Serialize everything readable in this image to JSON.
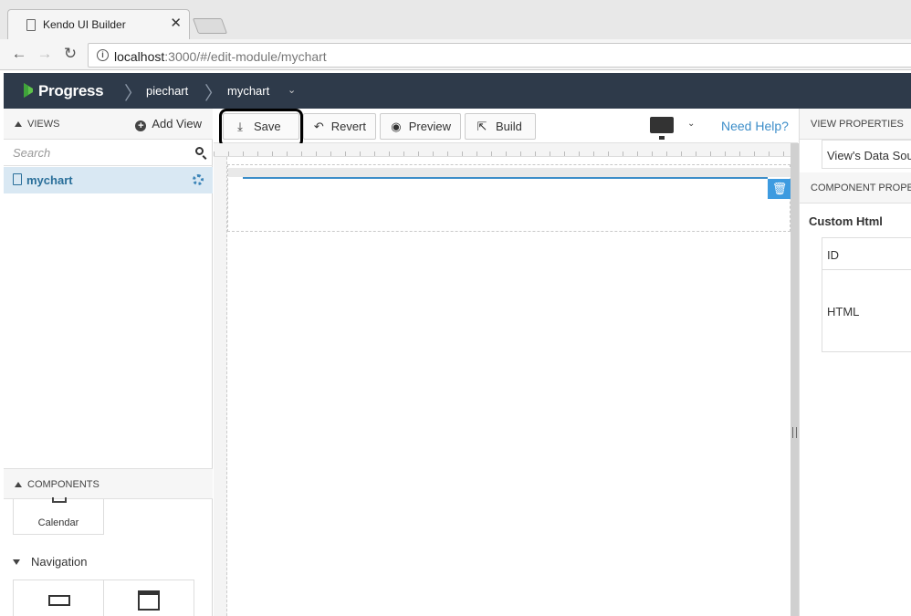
{
  "browser": {
    "tab_title": "Kendo UI Builder",
    "url_host": "localhost",
    "url_rest": ":3000/#/edit-module/mychart"
  },
  "header": {
    "brand": "Progress",
    "crumbs": [
      "piechart",
      "mychart"
    ]
  },
  "views": {
    "title": "VIEWS",
    "add_label": "Add View",
    "search_placeholder": "Search",
    "items": [
      {
        "label": "mychart"
      }
    ]
  },
  "components": {
    "title": "COMPONENTS",
    "calendar_label": "Calendar",
    "navigation_label": "Navigation"
  },
  "toolbar": {
    "save": "Save",
    "revert": "Revert",
    "preview": "Preview",
    "build": "Build",
    "help": "Need Help?"
  },
  "properties": {
    "view_title": "VIEW PROPERTIES",
    "view_data_source": "View's Data Sou",
    "component_title": "COMPONENT PROPE",
    "component_name": "Custom Html",
    "id_label": "ID",
    "html_label": "HTML"
  },
  "colors": {
    "header_bg": "#2e3a4a",
    "accent": "#3d8ec9",
    "selected_bg": "#d9e8f3",
    "logo_green": "#5ec24a"
  }
}
